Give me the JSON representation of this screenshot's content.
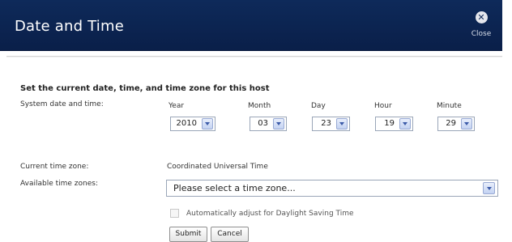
{
  "header": {
    "title": "Date and Time",
    "close_label": "Close",
    "close_icon": "close-icon",
    "background_color": "#0d2653"
  },
  "section": {
    "heading": "Set the current date, time, and time zone for this host"
  },
  "system_datetime": {
    "label": "System date and time:",
    "fields": [
      {
        "label": "Year",
        "value": "2010"
      },
      {
        "label": "Month",
        "value": "03"
      },
      {
        "label": "Day",
        "value": "23"
      },
      {
        "label": "Hour",
        "value": "19"
      },
      {
        "label": "Minute",
        "value": "29"
      }
    ]
  },
  "timezone": {
    "current_label": "Current time zone:",
    "current_value": "Coordinated Universal Time",
    "available_label": "Available time zones:",
    "available_value": "Please select a time zone..."
  },
  "dst": {
    "label": "Automatically adjust for Daylight Saving Time",
    "checked": false
  },
  "buttons": {
    "submit": "Submit",
    "cancel": "Cancel"
  }
}
